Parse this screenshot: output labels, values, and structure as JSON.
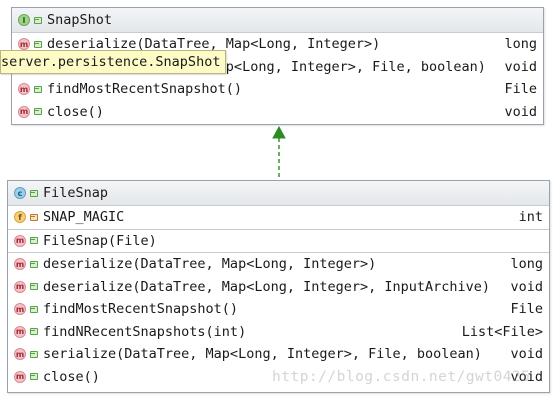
{
  "interface": {
    "kind_icon": "interface-icon",
    "name": "SnapShot",
    "methods": [
      {
        "signature": "deserialize(DataTree, Map<Long, Integer>)",
        "return_type": "long"
      },
      {
        "signature": "serialize(DataTree, Map<Long, Integer>, File, boolean)",
        "return_type": "void"
      },
      {
        "signature": "findMostRecentSnapshot()",
        "return_type": "File"
      },
      {
        "signature": "close()",
        "return_type": "void"
      }
    ]
  },
  "tooltip": {
    "text": "server.persistence.SnapShot",
    "visible_fragment": "ap<Long, Integer>, File, boolean)"
  },
  "relation": {
    "type": "implements",
    "style": "dashed",
    "color": "#2e8b22"
  },
  "class": {
    "kind_icon": "class-icon",
    "name": "FileSnap",
    "fields": [
      {
        "name": "SNAP_MAGIC",
        "type": "int"
      }
    ],
    "constructors": [
      {
        "signature": "FileSnap(File)"
      }
    ],
    "methods": [
      {
        "signature": "deserialize(DataTree, Map<Long, Integer>)",
        "return_type": "long"
      },
      {
        "signature": "deserialize(DataTree, Map<Long, Integer>, InputArchive)",
        "return_type": "void"
      },
      {
        "signature": "findMostRecentSnapshot()",
        "return_type": "File"
      },
      {
        "signature": "findNRecentSnapshots(int)",
        "return_type": "List<File>"
      },
      {
        "signature": "serialize(DataTree, Map<Long, Integer>, File, boolean)",
        "return_type": "void"
      },
      {
        "signature": "close()",
        "return_type": "void"
      }
    ]
  },
  "watermark": "http://blog.csdn.net/gwt0425"
}
